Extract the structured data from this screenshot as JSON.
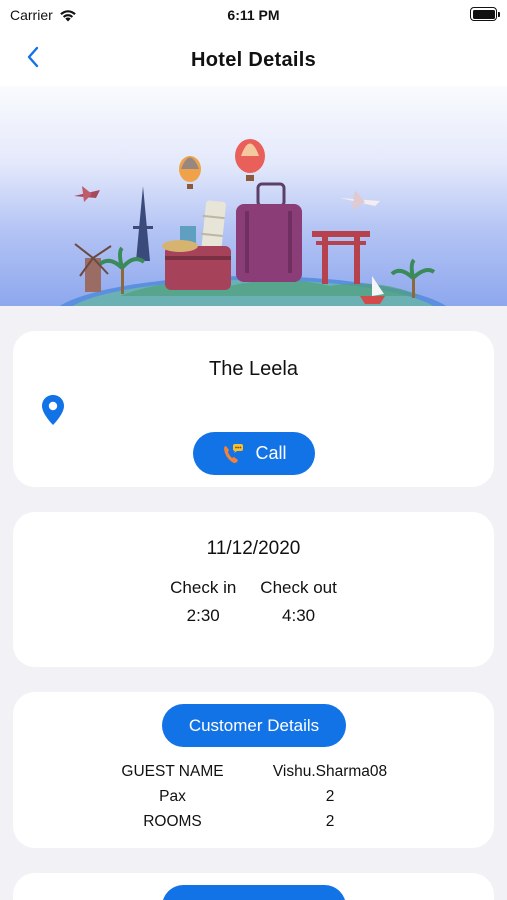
{
  "status_bar": {
    "carrier": "Carrier",
    "time": "6:11 PM"
  },
  "nav": {
    "title": "Hotel Details",
    "back_icon": "chevron-left-icon"
  },
  "hotel": {
    "name": "The Leela",
    "location_icon": "map-pin-icon",
    "call_label": "Call"
  },
  "booking": {
    "date": "11/12/2020",
    "check_in_label": "Check in",
    "check_in_time": "2:30",
    "check_out_label": "Check out",
    "check_out_time": "4:30"
  },
  "customer": {
    "button_label": "Customer Details",
    "rows": [
      {
        "label": "GUEST NAME",
        "value": "Vishu.Sharma08"
      },
      {
        "label": "Pax",
        "value": "2"
      },
      {
        "label": "ROOMS",
        "value": "2"
      }
    ]
  },
  "colors": {
    "accent": "#1273e6",
    "background": "#f2f2f6",
    "card": "#ffffff"
  }
}
